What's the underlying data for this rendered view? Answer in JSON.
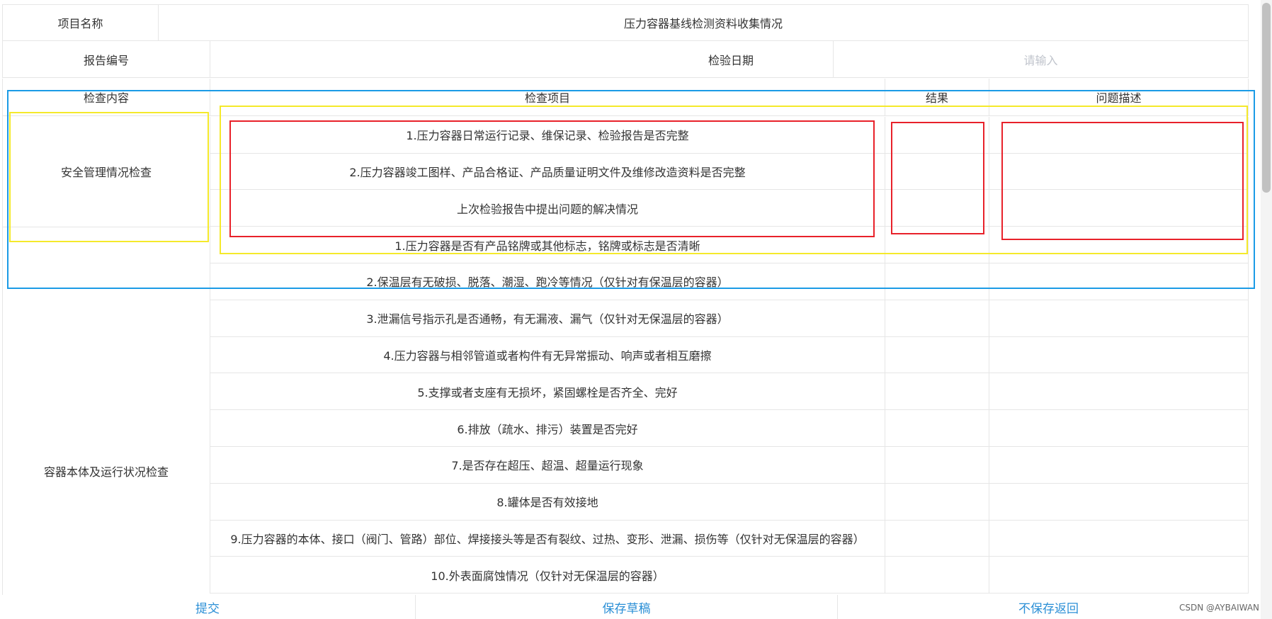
{
  "form": {
    "project_label": "项目名称",
    "project_value": "压力容器基线检测资料收集情况",
    "report_label": "报告编号",
    "date_label": "检验日期",
    "date_placeholder": "请输入"
  },
  "table": {
    "headers": [
      "检查内容",
      "检查项目",
      "结果",
      "问题描述"
    ],
    "sections": [
      {
        "category": "安全管理情况检查",
        "items": [
          "1.压力容器日常运行记录、维保记录、检验报告是否完整",
          "2.压力容器竣工图样、产品合格证、产品质量证明文件及维修改造资料是否完整",
          "上次检验报告中提出问题的解决情况"
        ]
      },
      {
        "category": "容器本体及运行状况检查",
        "items": [
          "1.压力容器是否有产品铭牌或其他标志，铭牌或标志是否清晰",
          "2.保温层有无破损、脱落、潮湿、跑冷等情况（仅针对有保温层的容器）",
          "3.泄漏信号指示孔是否通畅，有无漏液、漏气（仅针对无保温层的容器）",
          "4.压力容器与相邻管道或者构件有无异常振动、响声或者相互磨擦",
          "5.支撑或者支座有无损坏，紧固螺栓是否齐全、完好",
          "6.排放（疏水、排污）装置是否完好",
          "7.是否存在超压、超温、超量运行现象",
          "8.罐体是否有效接地",
          "9.压力容器的本体、接口（阀门、管路）部位、焊接接头等是否有裂纹、过热、变形、泄漏、损伤等（仅针对无保温层的容器）",
          "10.外表面腐蚀情况（仅针对无保温层的容器）"
        ]
      }
    ]
  },
  "footer": {
    "submit": "提交",
    "save_draft": "保存草稿",
    "back_without_save": "不保存返回"
  },
  "watermark": "CSDN @AYBAIWAN",
  "colors": {
    "border": "#e6e6e6",
    "text": "#333333",
    "placeholder": "#c0c4cc",
    "link": "#2b8fd6",
    "annotation_blue": "#1b9be6",
    "annotation_yellow": "#f5e92b",
    "annotation_red": "#e8212a"
  }
}
